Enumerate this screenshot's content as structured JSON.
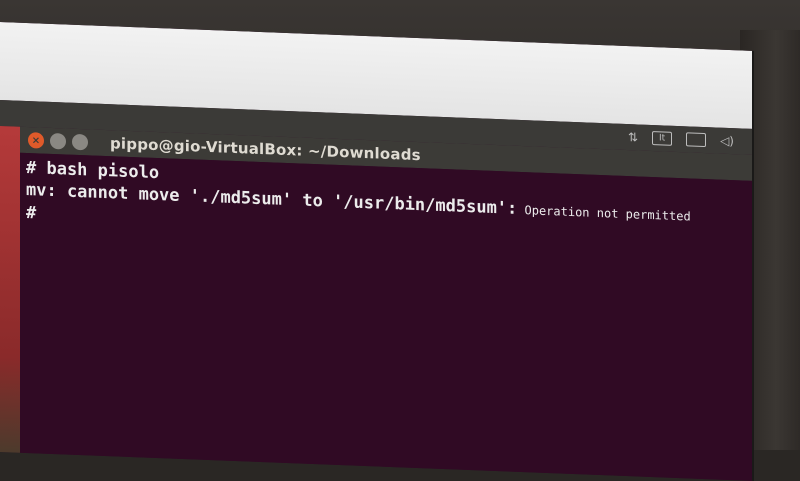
{
  "window": {
    "title": "pippo@gio-VirtualBox: ~/Downloads"
  },
  "panel": {
    "icons": [
      "network-icon",
      "keyboard-icon",
      "battery-icon",
      "volume-icon"
    ],
    "keyboard_label": "It"
  },
  "terminal": {
    "lines": [
      {
        "text": "# bash pisolo"
      },
      {
        "text_main": "mv: cannot move './md5sum' to '/usr/bin/md5sum':",
        "text_tail": " Operation not permitted"
      },
      {
        "text": "#"
      }
    ]
  },
  "colors": {
    "terminal_bg": "#300a24",
    "titlebar": "#3c3b37",
    "close_button": "#e05a2a",
    "text": "#ececec"
  }
}
